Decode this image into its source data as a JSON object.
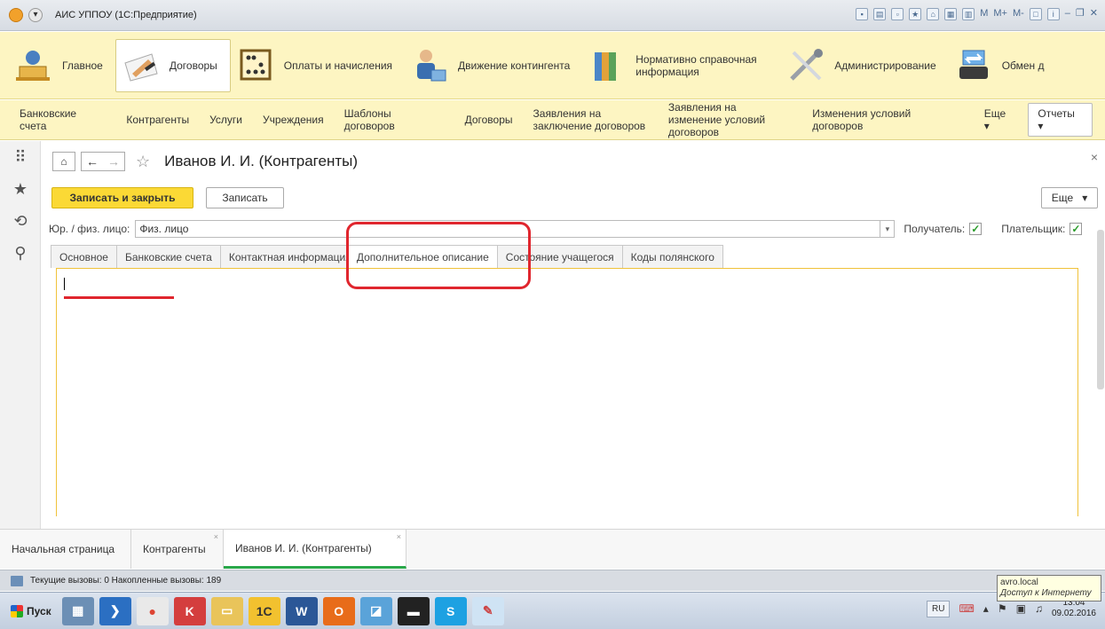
{
  "titlebar": {
    "title": "АИС УППОУ (1С:Предприятие)"
  },
  "sections": [
    {
      "label": "Главное",
      "icon": "home-icon"
    },
    {
      "label": "Договоры",
      "icon": "contract-signing-icon"
    },
    {
      "label": "Оплаты и начисления",
      "icon": "abacus-icon"
    },
    {
      "label": "Движение контингента",
      "icon": "people-movement-icon"
    },
    {
      "label": "Нормативно справочная информация",
      "icon": "reference-books-icon"
    },
    {
      "label": "Администрирование",
      "icon": "tools-icon"
    },
    {
      "label": "Обмен д",
      "icon": "exchange-icon"
    }
  ],
  "commands": {
    "items": [
      "Банковские счета",
      "Контрагенты",
      "Услуги",
      "Учреждения",
      "Шаблоны договоров",
      "Договоры",
      "Заявления на заключение договоров",
      "Заявления на изменение условий договоров",
      "Изменения условий договоров"
    ],
    "more": "Еще ▾",
    "reports": "Отчеты ▾"
  },
  "form": {
    "title": "Иванов И. И. (Контрагенты)",
    "save_close": "Записать и закрыть",
    "save": "Записать",
    "more": "Еще",
    "legal_label": "Юр. / физ. лицо:",
    "legal_value": "Физ. лицо",
    "recipient_label": "Получатель:",
    "payer_label": "Плательщик:",
    "tabs": [
      "Основное",
      "Банковские счета",
      "Контактная информация",
      "Дополнительное описание",
      "Состояние учащегося",
      "Коды полянского"
    ],
    "description_value": ""
  },
  "windows": [
    {
      "label": "Начальная страница"
    },
    {
      "label": "Контрагенты"
    },
    {
      "label": "Иванов И. И. (Контрагенты)"
    }
  ],
  "status": {
    "calls": "Текущие вызовы: 0   Накопленные вызовы: 189"
  },
  "network_tip": {
    "domain": "avro.local",
    "access": "Доступ к Интернету"
  },
  "taskbar": {
    "start": "Пуск",
    "lang": "RU",
    "time": "13:04",
    "date": "09.02.2016"
  },
  "colors": {
    "sections_bg": "#fdf5c2",
    "primary_button": "#fbd935",
    "annotation_red": "#e0262e",
    "active_window_underline": "#2aa84a"
  }
}
